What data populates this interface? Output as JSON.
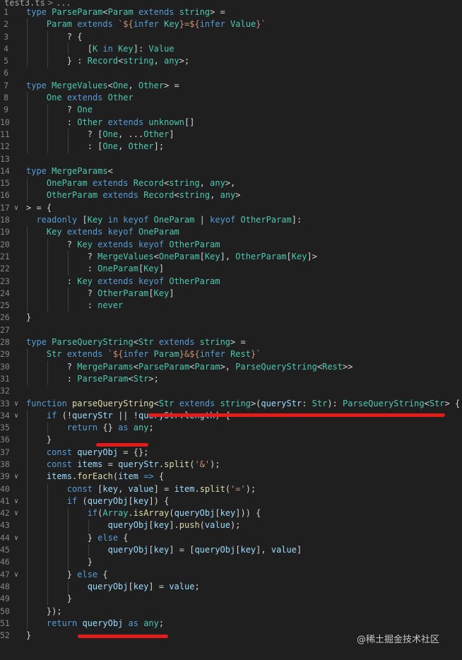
{
  "breadcrumb": {
    "file": "test3.ts",
    "separator": ">",
    "more": "..."
  },
  "watermark": "@稀土掘金技术社区",
  "lines": [
    {
      "n": "1",
      "fold": "",
      "indent": 0,
      "t": [
        [
          "kw",
          "type "
        ],
        [
          "ty",
          "ParseParam"
        ],
        [
          "pl",
          "<"
        ],
        [
          "ty",
          "Param"
        ],
        [
          "kw",
          " extends "
        ],
        [
          "ty",
          "string"
        ],
        [
          "pl",
          "> ="
        ]
      ]
    },
    {
      "n": "2",
      "fold": "",
      "indent": 4,
      "t": [
        [
          "ty",
          "Param"
        ],
        [
          "kw",
          " extends "
        ],
        [
          "st",
          "`${"
        ],
        [
          "kw",
          "infer "
        ],
        [
          "ty",
          "Key"
        ],
        [
          "st",
          "}=${"
        ],
        [
          "kw",
          "infer "
        ],
        [
          "ty",
          "Value"
        ],
        [
          "st",
          "}`"
        ]
      ]
    },
    {
      "n": "3",
      "fold": "",
      "indent": 8,
      "t": [
        [
          "pl",
          "? {"
        ]
      ]
    },
    {
      "n": "4",
      "fold": "",
      "indent": 12,
      "t": [
        [
          "pl",
          "["
        ],
        [
          "ty",
          "K"
        ],
        [
          "kw",
          " in "
        ],
        [
          "ty",
          "Key"
        ],
        [
          "pl",
          "]: "
        ],
        [
          "ty",
          "Value"
        ]
      ]
    },
    {
      "n": "5",
      "fold": "",
      "indent": 8,
      "t": [
        [
          "pl",
          "} : "
        ],
        [
          "ty",
          "Record"
        ],
        [
          "pl",
          "<"
        ],
        [
          "ty",
          "string"
        ],
        [
          "pl",
          ", "
        ],
        [
          "ty",
          "any"
        ],
        [
          "pl",
          ">;"
        ]
      ]
    },
    {
      "n": "6",
      "fold": "",
      "indent": 0,
      "t": []
    },
    {
      "n": "7",
      "fold": "",
      "indent": 0,
      "t": [
        [
          "kw",
          "type "
        ],
        [
          "ty",
          "MergeValues"
        ],
        [
          "pl",
          "<"
        ],
        [
          "ty",
          "One"
        ],
        [
          "pl",
          ", "
        ],
        [
          "ty",
          "Other"
        ],
        [
          "pl",
          "> ="
        ]
      ]
    },
    {
      "n": "8",
      "fold": "",
      "indent": 4,
      "t": [
        [
          "ty",
          "One"
        ],
        [
          "kw",
          " extends "
        ],
        [
          "ty",
          "Other"
        ]
      ]
    },
    {
      "n": "9",
      "fold": "",
      "indent": 8,
      "t": [
        [
          "pl",
          "? "
        ],
        [
          "ty",
          "One"
        ]
      ]
    },
    {
      "n": "10",
      "fold": "",
      "indent": 8,
      "t": [
        [
          "pl",
          ": "
        ],
        [
          "ty",
          "Other"
        ],
        [
          "kw",
          " extends "
        ],
        [
          "ty",
          "unknown"
        ],
        [
          "pl",
          "[]"
        ]
      ]
    },
    {
      "n": "11",
      "fold": "",
      "indent": 12,
      "t": [
        [
          "pl",
          "? ["
        ],
        [
          "ty",
          "One"
        ],
        [
          "pl",
          ", ..."
        ],
        [
          "ty",
          "Other"
        ],
        [
          "pl",
          "]"
        ]
      ]
    },
    {
      "n": "12",
      "fold": "",
      "indent": 12,
      "t": [
        [
          "pl",
          ": ["
        ],
        [
          "ty",
          "One"
        ],
        [
          "pl",
          ", "
        ],
        [
          "ty",
          "Other"
        ],
        [
          "pl",
          "];"
        ]
      ]
    },
    {
      "n": "13",
      "fold": "",
      "indent": 0,
      "t": []
    },
    {
      "n": "14",
      "fold": "",
      "indent": 0,
      "t": [
        [
          "kw",
          "type "
        ],
        [
          "ty",
          "MergeParams"
        ],
        [
          "pl",
          "<"
        ]
      ]
    },
    {
      "n": "15",
      "fold": "",
      "indent": 4,
      "t": [
        [
          "ty",
          "OneParam"
        ],
        [
          "kw",
          " extends "
        ],
        [
          "ty",
          "Record"
        ],
        [
          "pl",
          "<"
        ],
        [
          "ty",
          "string"
        ],
        [
          "pl",
          ", "
        ],
        [
          "ty",
          "any"
        ],
        [
          "pl",
          ">,"
        ]
      ]
    },
    {
      "n": "16",
      "fold": "",
      "indent": 4,
      "t": [
        [
          "ty",
          "OtherParam"
        ],
        [
          "kw",
          " extends "
        ],
        [
          "ty",
          "Record"
        ],
        [
          "pl",
          "<"
        ],
        [
          "ty",
          "string"
        ],
        [
          "pl",
          ", "
        ],
        [
          "ty",
          "any"
        ],
        [
          "pl",
          ">"
        ]
      ]
    },
    {
      "n": "17",
      "fold": "v",
      "indent": 0,
      "t": [
        [
          "pl",
          "> = {"
        ]
      ]
    },
    {
      "n": "18",
      "fold": "",
      "indent": 2,
      "t": [
        [
          "kw",
          "readonly "
        ],
        [
          "pl",
          "["
        ],
        [
          "ty",
          "Key"
        ],
        [
          "kw",
          " in keyof "
        ],
        [
          "ty",
          "OneParam"
        ],
        [
          "pl",
          " | "
        ],
        [
          "kw",
          "keyof "
        ],
        [
          "ty",
          "OtherParam"
        ],
        [
          "pl",
          "]:"
        ]
      ]
    },
    {
      "n": "19",
      "fold": "",
      "indent": 4,
      "t": [
        [
          "ty",
          "Key"
        ],
        [
          "kw",
          " extends keyof "
        ],
        [
          "ty",
          "OneParam"
        ]
      ]
    },
    {
      "n": "20",
      "fold": "",
      "indent": 8,
      "t": [
        [
          "pl",
          "? "
        ],
        [
          "ty",
          "Key"
        ],
        [
          "kw",
          " extends keyof "
        ],
        [
          "ty",
          "OtherParam"
        ]
      ]
    },
    {
      "n": "21",
      "fold": "",
      "indent": 12,
      "t": [
        [
          "pl",
          "? "
        ],
        [
          "ty",
          "MergeValues"
        ],
        [
          "pl",
          "<"
        ],
        [
          "ty",
          "OneParam"
        ],
        [
          "pl",
          "["
        ],
        [
          "ty",
          "Key"
        ],
        [
          "pl",
          "], "
        ],
        [
          "ty",
          "OtherParam"
        ],
        [
          "pl",
          "["
        ],
        [
          "ty",
          "Key"
        ],
        [
          "pl",
          "]>"
        ]
      ]
    },
    {
      "n": "22",
      "fold": "",
      "indent": 12,
      "t": [
        [
          "pl",
          ": "
        ],
        [
          "ty",
          "OneParam"
        ],
        [
          "pl",
          "["
        ],
        [
          "ty",
          "Key"
        ],
        [
          "pl",
          "]"
        ]
      ]
    },
    {
      "n": "23",
      "fold": "",
      "indent": 8,
      "t": [
        [
          "pl",
          ": "
        ],
        [
          "ty",
          "Key"
        ],
        [
          "kw",
          " extends keyof "
        ],
        [
          "ty",
          "OtherParam"
        ]
      ]
    },
    {
      "n": "24",
      "fold": "",
      "indent": 12,
      "t": [
        [
          "pl",
          "? "
        ],
        [
          "ty",
          "OtherParam"
        ],
        [
          "pl",
          "["
        ],
        [
          "ty",
          "Key"
        ],
        [
          "pl",
          "]"
        ]
      ]
    },
    {
      "n": "25",
      "fold": "",
      "indent": 12,
      "t": [
        [
          "pl",
          ": "
        ],
        [
          "ty",
          "never"
        ]
      ]
    },
    {
      "n": "26",
      "fold": "",
      "indent": 0,
      "t": [
        [
          "pl",
          "}"
        ]
      ]
    },
    {
      "n": "27",
      "fold": "",
      "indent": 0,
      "t": []
    },
    {
      "n": "28",
      "fold": "",
      "indent": 0,
      "t": [
        [
          "kw",
          "type "
        ],
        [
          "ty",
          "ParseQueryString"
        ],
        [
          "pl",
          "<"
        ],
        [
          "ty",
          "Str"
        ],
        [
          "kw",
          " extends "
        ],
        [
          "ty",
          "string"
        ],
        [
          "pl",
          "> ="
        ]
      ]
    },
    {
      "n": "29",
      "fold": "",
      "indent": 4,
      "t": [
        [
          "ty",
          "Str"
        ],
        [
          "kw",
          " extends "
        ],
        [
          "st",
          "`${"
        ],
        [
          "kw",
          "infer "
        ],
        [
          "ty",
          "Param"
        ],
        [
          "st",
          "}&${"
        ],
        [
          "kw",
          "infer "
        ],
        [
          "ty",
          "Rest"
        ],
        [
          "st",
          "}`"
        ]
      ]
    },
    {
      "n": "30",
      "fold": "",
      "indent": 8,
      "t": [
        [
          "pl",
          "? "
        ],
        [
          "ty",
          "MergeParams"
        ],
        [
          "pl",
          "<"
        ],
        [
          "ty",
          "ParseParam"
        ],
        [
          "pl",
          "<"
        ],
        [
          "ty",
          "Param"
        ],
        [
          "pl",
          ">, "
        ],
        [
          "ty",
          "ParseQueryString"
        ],
        [
          "pl",
          "<"
        ],
        [
          "ty",
          "Rest"
        ],
        [
          "pl",
          ">>"
        ]
      ]
    },
    {
      "n": "31",
      "fold": "",
      "indent": 8,
      "t": [
        [
          "pl",
          ": "
        ],
        [
          "ty",
          "ParseParam"
        ],
        [
          "pl",
          "<"
        ],
        [
          "ty",
          "Str"
        ],
        [
          "pl",
          ">;"
        ]
      ]
    },
    {
      "n": "32",
      "fold": "",
      "indent": 0,
      "t": []
    },
    {
      "n": "33",
      "fold": "v",
      "indent": 0,
      "t": [
        [
          "kw",
          "function "
        ],
        [
          "fn",
          "parseQueryString"
        ],
        [
          "pl",
          "<"
        ],
        [
          "ty",
          "Str"
        ],
        [
          "kw",
          " extends "
        ],
        [
          "ty",
          "string"
        ],
        [
          "pl",
          ">("
        ],
        [
          "va",
          "queryStr"
        ],
        [
          "pl",
          ": "
        ],
        [
          "ty",
          "Str"
        ],
        [
          "pl",
          "): "
        ],
        [
          "ty",
          "ParseQueryString"
        ],
        [
          "pl",
          "<"
        ],
        [
          "ty",
          "Str"
        ],
        [
          "pl",
          "> {"
        ]
      ]
    },
    {
      "n": "34",
      "fold": "v",
      "indent": 4,
      "t": [
        [
          "kw",
          "if "
        ],
        [
          "pl",
          "(!"
        ],
        [
          "va",
          "queryStr"
        ],
        [
          "pl",
          " || !"
        ],
        [
          "va",
          "queryStr"
        ],
        [
          "pl",
          "."
        ],
        [
          "va",
          "length"
        ],
        [
          "pl",
          ") {"
        ]
      ]
    },
    {
      "n": "35",
      "fold": "",
      "indent": 8,
      "t": [
        [
          "kw",
          "return "
        ],
        [
          "pl",
          "{} "
        ],
        [
          "kw",
          "as "
        ],
        [
          "ty",
          "any"
        ],
        [
          "pl",
          ";"
        ]
      ]
    },
    {
      "n": "36",
      "fold": "",
      "indent": 4,
      "t": [
        [
          "pl",
          "}"
        ]
      ]
    },
    {
      "n": "37",
      "fold": "",
      "indent": 4,
      "t": [
        [
          "kw",
          "const "
        ],
        [
          "va",
          "queryObj"
        ],
        [
          "pl",
          " = {};"
        ]
      ]
    },
    {
      "n": "38",
      "fold": "",
      "indent": 4,
      "t": [
        [
          "kw",
          "const "
        ],
        [
          "va",
          "items"
        ],
        [
          "pl",
          " = "
        ],
        [
          "va",
          "queryStr"
        ],
        [
          "pl",
          "."
        ],
        [
          "fn",
          "split"
        ],
        [
          "pl",
          "("
        ],
        [
          "st",
          "'&'"
        ],
        [
          "pl",
          ");"
        ]
      ]
    },
    {
      "n": "39",
      "fold": "v",
      "indent": 4,
      "t": [
        [
          "va",
          "items"
        ],
        [
          "pl",
          "."
        ],
        [
          "fn",
          "forEach"
        ],
        [
          "pl",
          "("
        ],
        [
          "va",
          "item"
        ],
        [
          "kw",
          " => "
        ],
        [
          "pl",
          "{"
        ]
      ]
    },
    {
      "n": "40",
      "fold": "",
      "indent": 8,
      "t": [
        [
          "kw",
          "const "
        ],
        [
          "pl",
          "["
        ],
        [
          "va",
          "key"
        ],
        [
          "pl",
          ", "
        ],
        [
          "va",
          "value"
        ],
        [
          "pl",
          "] = "
        ],
        [
          "va",
          "item"
        ],
        [
          "pl",
          "."
        ],
        [
          "fn",
          "split"
        ],
        [
          "pl",
          "("
        ],
        [
          "st",
          "'='"
        ],
        [
          "pl",
          ");"
        ]
      ]
    },
    {
      "n": "41",
      "fold": "v",
      "indent": 8,
      "t": [
        [
          "kw",
          "if "
        ],
        [
          "pl",
          "("
        ],
        [
          "va",
          "queryObj"
        ],
        [
          "pl",
          "["
        ],
        [
          "va",
          "key"
        ],
        [
          "pl",
          "]) {"
        ]
      ]
    },
    {
      "n": "42",
      "fold": "v",
      "indent": 12,
      "t": [
        [
          "kw",
          "if"
        ],
        [
          "pl",
          "("
        ],
        [
          "ty",
          "Array"
        ],
        [
          "pl",
          "."
        ],
        [
          "fn",
          "isArray"
        ],
        [
          "pl",
          "("
        ],
        [
          "va",
          "queryObj"
        ],
        [
          "pl",
          "["
        ],
        [
          "va",
          "key"
        ],
        [
          "pl",
          "])) {"
        ]
      ]
    },
    {
      "n": "43",
      "fold": "",
      "indent": 16,
      "t": [
        [
          "va",
          "queryObj"
        ],
        [
          "pl",
          "["
        ],
        [
          "va",
          "key"
        ],
        [
          "pl",
          "]."
        ],
        [
          "fn",
          "push"
        ],
        [
          "pl",
          "("
        ],
        [
          "va",
          "value"
        ],
        [
          "pl",
          ");"
        ]
      ]
    },
    {
      "n": "44",
      "fold": "v",
      "indent": 12,
      "t": [
        [
          "pl",
          "} "
        ],
        [
          "kw",
          "else "
        ],
        [
          "pl",
          "{"
        ]
      ]
    },
    {
      "n": "45",
      "fold": "",
      "indent": 16,
      "t": [
        [
          "va",
          "queryObj"
        ],
        [
          "pl",
          "["
        ],
        [
          "va",
          "key"
        ],
        [
          "pl",
          "] = ["
        ],
        [
          "va",
          "queryObj"
        ],
        [
          "pl",
          "["
        ],
        [
          "va",
          "key"
        ],
        [
          "pl",
          "], "
        ],
        [
          "va",
          "value"
        ],
        [
          "pl",
          "]"
        ]
      ]
    },
    {
      "n": "46",
      "fold": "",
      "indent": 12,
      "t": [
        [
          "pl",
          "}"
        ]
      ]
    },
    {
      "n": "47",
      "fold": "v",
      "indent": 8,
      "t": [
        [
          "pl",
          "} "
        ],
        [
          "kw",
          "else "
        ],
        [
          "pl",
          "{"
        ]
      ]
    },
    {
      "n": "48",
      "fold": "",
      "indent": 12,
      "t": [
        [
          "va",
          "queryObj"
        ],
        [
          "pl",
          "["
        ],
        [
          "va",
          "key"
        ],
        [
          "pl",
          "] = "
        ],
        [
          "va",
          "value"
        ],
        [
          "pl",
          ";"
        ]
      ]
    },
    {
      "n": "49",
      "fold": "",
      "indent": 8,
      "t": [
        [
          "pl",
          "}"
        ]
      ]
    },
    {
      "n": "50",
      "fold": "",
      "indent": 4,
      "t": [
        [
          "pl",
          "});"
        ]
      ]
    },
    {
      "n": "51",
      "fold": "",
      "indent": 4,
      "t": [
        [
          "kw",
          "return "
        ],
        [
          "va",
          "queryObj"
        ],
        [
          "kw",
          " as "
        ],
        [
          "ty",
          "any"
        ],
        [
          "pl",
          ";"
        ]
      ]
    },
    {
      "n": "52",
      "fold": "",
      "indent": 0,
      "t": [
        [
          "pl",
          "}"
        ]
      ]
    }
  ]
}
